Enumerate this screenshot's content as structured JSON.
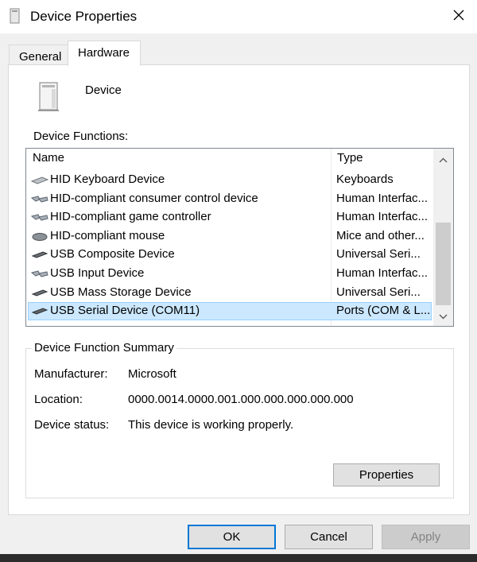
{
  "window": {
    "title": "Device Properties"
  },
  "tabs": [
    {
      "label": "General",
      "active": false
    },
    {
      "label": "Hardware",
      "active": true
    }
  ],
  "device": {
    "name": "Device"
  },
  "functions": {
    "label": "Device Functions:",
    "columns": {
      "name": "Name",
      "type": "Type"
    },
    "rows": [
      {
        "name": "HID Keyboard Device",
        "type": "Keyboards",
        "icon": "keyboard-icon",
        "selected": false
      },
      {
        "name": "HID-compliant consumer control device",
        "type": "Human Interfac...",
        "icon": "hid-icon",
        "selected": false
      },
      {
        "name": "HID-compliant game controller",
        "type": "Human Interfac...",
        "icon": "hid-icon",
        "selected": false
      },
      {
        "name": "HID-compliant mouse",
        "type": "Mice and other...",
        "icon": "mouse-icon",
        "selected": false
      },
      {
        "name": "USB Composite Device",
        "type": "Universal Seri...",
        "icon": "usb-icon",
        "selected": false
      },
      {
        "name": "USB Input Device",
        "type": "Human Interfac...",
        "icon": "hid-icon",
        "selected": false
      },
      {
        "name": "USB Mass Storage Device",
        "type": "Universal Seri...",
        "icon": "usb-icon",
        "selected": false
      },
      {
        "name": "USB Serial Device (COM11)",
        "type": "Ports (COM & L...",
        "icon": "port-icon",
        "selected": true
      }
    ]
  },
  "summary": {
    "title": "Device Function Summary",
    "manufacturer_label": "Manufacturer:",
    "manufacturer_value": "Microsoft",
    "location_label": "Location:",
    "location_value": "0000.0014.0000.001.000.000.000.000.000",
    "status_label": "Device status:",
    "status_value": "This device is working properly.",
    "properties_button": "Properties"
  },
  "buttons": {
    "ok": "OK",
    "cancel": "Cancel",
    "apply": "Apply"
  },
  "colors": {
    "selection": "#cce8ff",
    "selection_border": "#99d1ff",
    "default_button_border": "#0078d7"
  }
}
